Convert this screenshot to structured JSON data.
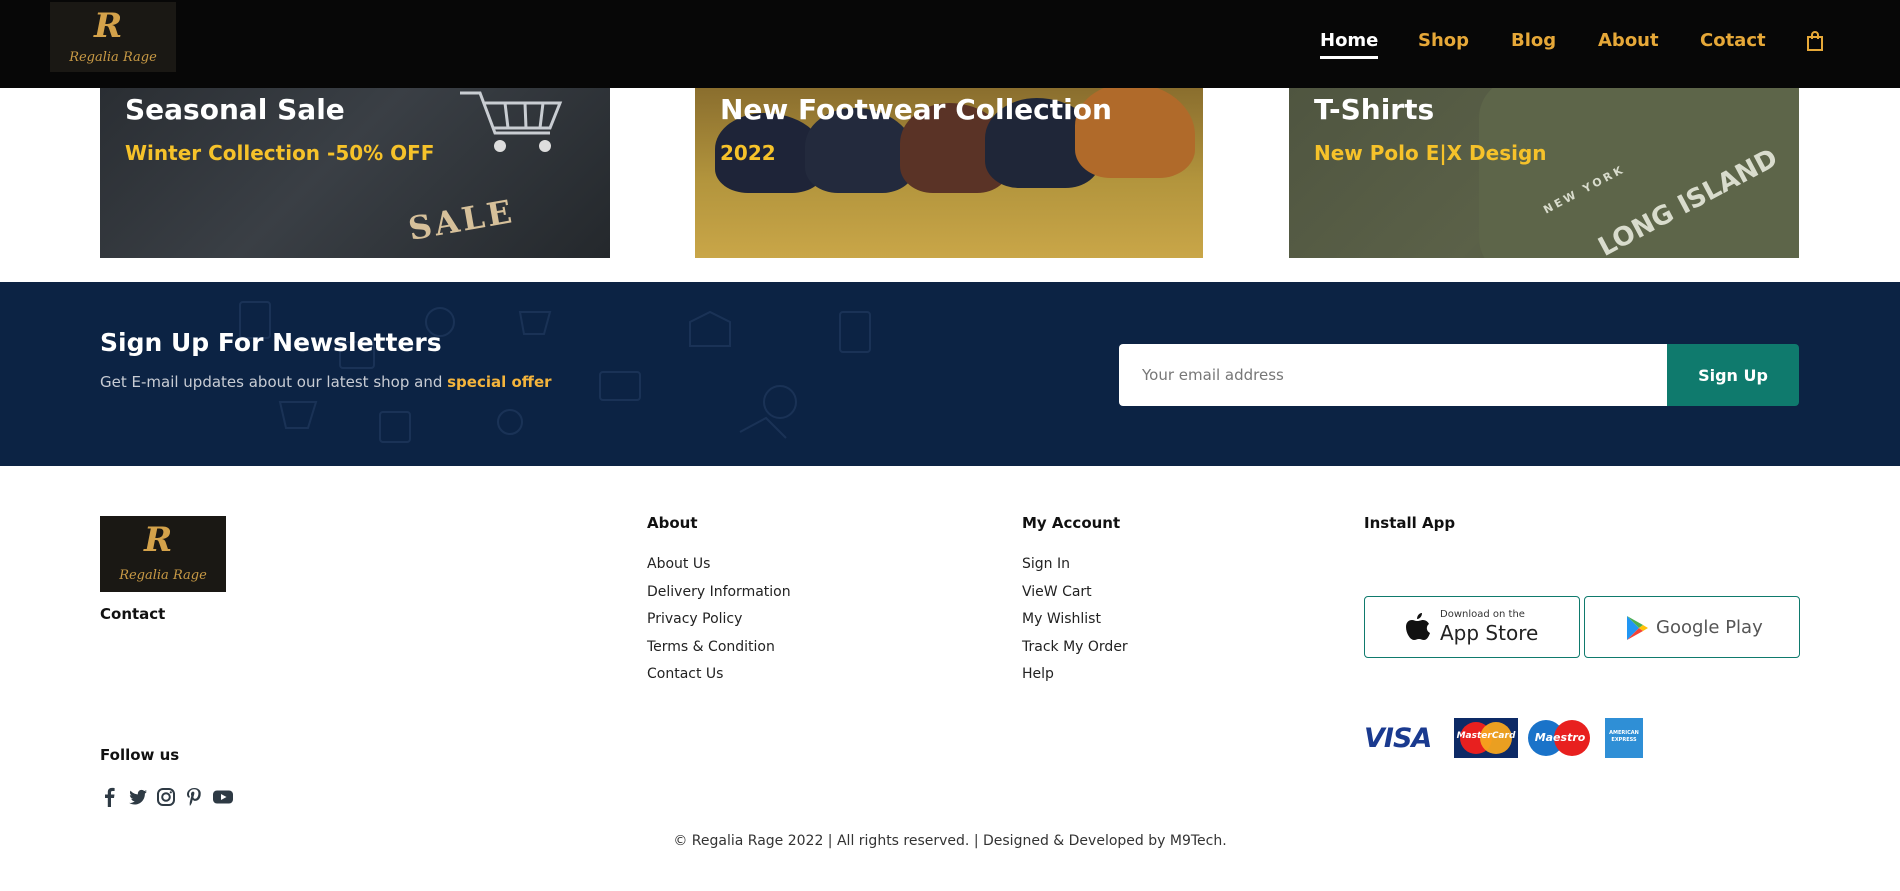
{
  "brand": {
    "monogram": "R",
    "name": "Regalia Rage"
  },
  "nav": {
    "items": [
      {
        "label": "Home",
        "active": true
      },
      {
        "label": "Shop"
      },
      {
        "label": "Blog"
      },
      {
        "label": "About"
      },
      {
        "label": "Cotact"
      }
    ],
    "cart_icon": "shopping-bag-icon"
  },
  "promos": [
    {
      "title": "Seasonal Sale",
      "subtitle": "Winter Collection -50% OFF",
      "image_text": "SALE"
    },
    {
      "title": "New Footwear Collection",
      "subtitle": "2022"
    },
    {
      "title": "T-Shirts",
      "subtitle": "New Polo E|X Design",
      "image_text_1": "NEW YORK",
      "image_text_2": "LONG ISLAND"
    }
  ],
  "newsletter": {
    "title": "Sign Up For Newsletters",
    "text": "Get E-mail updates about our latest shop and",
    "highlight": "special offer",
    "email_placeholder": "Your email address",
    "button": "Sign Up"
  },
  "footer": {
    "contact_heading": "Contact",
    "follow_heading": "Follow us",
    "social_icons": [
      "facebook-icon",
      "twitter-icon",
      "instagram-icon",
      "pinterest-icon",
      "youtube-icon"
    ],
    "about": {
      "heading": "About",
      "links": [
        "About Us",
        "Delivery Information",
        "Privacy Policy",
        "Terms & Condition",
        "Contact Us"
      ]
    },
    "account": {
      "heading": "My Account",
      "links": [
        "Sign In",
        "VieW Cart",
        "My Wishlist",
        "Track My Order",
        "Help"
      ]
    },
    "install": {
      "heading": "Install App",
      "appstore_small": "Download on the",
      "appstore_big": "App Store",
      "googleplay": "Google Play"
    },
    "payments": [
      "VISA",
      "MasterCard",
      "Maestro",
      "AMERICAN EXPRESS"
    ],
    "copyright": "© Regalia Rage 2022 | All rights reserved. | Designed & Developed by M9Tech."
  },
  "colors": {
    "header_bg": "#070707",
    "nav_accent": "#e6a838",
    "newsletter_bg": "#0c2344",
    "highlight": "#f4b43c",
    "primary_button": "#0f7a6d",
    "promo_subtitle": "#f6c22a"
  }
}
